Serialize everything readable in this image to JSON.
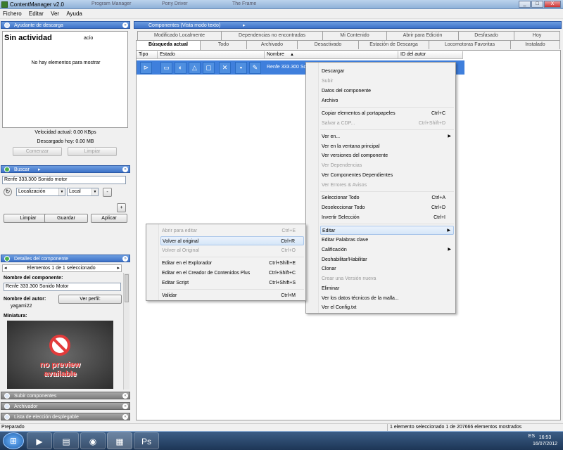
{
  "window": {
    "title": "ContentManager v2.0",
    "ghost_tabs": [
      "Program Manager",
      "Pony Driver",
      "The Frame"
    ],
    "controls": [
      "_",
      "□",
      "X"
    ]
  },
  "menubar": [
    "Fichero",
    "Editar",
    "Ver",
    "Ayuda"
  ],
  "download_panel": {
    "header": "Ayudante de descarga",
    "status": "Sin actividad",
    "status_side": "acío",
    "empty_msg": "No hay elementos para mostrar",
    "speed": "Velocidad actual: 0.00 KBps",
    "downloaded": "Descargado hoy: 0.00 MB",
    "btn_start": "Comenzar",
    "btn_clear": "Limpiar"
  },
  "search_panel": {
    "header": "Buscar",
    "query": "Renfe 333.300 Sonido motor",
    "loc": "Localización",
    "local": "Local",
    "minus": "-",
    "plus": "+",
    "btn_clear": "Limpiar",
    "btn_save": "Guardar",
    "btn_apply": "Aplicar"
  },
  "details_panel": {
    "header": "Detalles del componente",
    "nav": "Elementos 1 de 1 seleccionado",
    "name_label": "Nombre del componente:",
    "name_value": "Renfe 333.300 Sonido Motor",
    "author_label": "Nombre del autor:",
    "author_btn": "Ver perfil:",
    "author_value": "yagami22",
    "thumb_label": "Miniatura:",
    "no_preview_1": "no preview",
    "no_preview_2": "available"
  },
  "bottom_panels": [
    "Subir componentes",
    "Archivador",
    "Lista de elección desplegable"
  ],
  "components": {
    "header": "Componentes (Vista modo texto)",
    "tabs_row1": [
      "Modificado Localmente",
      "Dependencias no encontradas",
      "Mi Contenido",
      "Abrir para Edición",
      "Desfasado",
      "Hoy"
    ],
    "tabs_row2": [
      "Búsqueda actual",
      "Todo",
      "Archivado",
      "Desactivado",
      "Estación de Descarga",
      "Locomotoras Favoritas",
      "Instalado"
    ],
    "columns": [
      "Tipo",
      "Estado",
      "Nombre",
      "ID del autor"
    ],
    "row": {
      "name": "Renfe 333.300 Sonido"
    }
  },
  "context_menu": {
    "items": [
      {
        "label": "Descargar",
        "shortcut": "",
        "enabled": true
      },
      {
        "label": "Subir",
        "shortcut": "",
        "enabled": false
      },
      {
        "label": "Datos del componente",
        "shortcut": "",
        "enabled": true
      },
      {
        "label": "Archivo",
        "shortcut": "",
        "enabled": true
      },
      {
        "label": "Copiar elementos al portapapeles",
        "shortcut": "Ctrl+C",
        "enabled": true
      },
      {
        "label": "Salvar a CDP...",
        "shortcut": "Ctrl+Shift+D",
        "enabled": false
      },
      {
        "label": "Ver en...",
        "shortcut": "",
        "enabled": true
      },
      {
        "label": "Ver en la ventana principal",
        "shortcut": "",
        "enabled": true
      },
      {
        "label": "Ver versiones del componente",
        "shortcut": "",
        "enabled": true
      },
      {
        "label": "Ver Dependencias",
        "shortcut": "",
        "enabled": false
      },
      {
        "label": "Ver Componentes Dependientes",
        "shortcut": "",
        "enabled": true
      },
      {
        "label": "Ver Errores & Avisos",
        "shortcut": "",
        "enabled": false
      },
      {
        "label": "Seleccionar Todo",
        "shortcut": "Ctrl+A",
        "enabled": true
      },
      {
        "label": "Deseleccionar Todo",
        "shortcut": "Ctrl+D",
        "enabled": true
      },
      {
        "label": "Invertir Selección",
        "shortcut": "Ctrl+I",
        "enabled": true
      },
      {
        "label": "Editar",
        "shortcut": "",
        "enabled": true
      },
      {
        "label": "Editar Palabras clave",
        "shortcut": "",
        "enabled": true
      },
      {
        "label": "Calificación",
        "shortcut": "",
        "enabled": true
      },
      {
        "label": "Deshabilitar/Habilitar",
        "shortcut": "",
        "enabled": true
      },
      {
        "label": "Clonar",
        "shortcut": "",
        "enabled": true
      },
      {
        "label": "Crear una Versión nueva",
        "shortcut": "",
        "enabled": false
      },
      {
        "label": "Eliminar",
        "shortcut": "",
        "enabled": true
      },
      {
        "label": "Ver los datos técnicos de la malla...",
        "shortcut": "",
        "enabled": true
      },
      {
        "label": "Ver el Config.txt",
        "shortcut": "",
        "enabled": true
      }
    ]
  },
  "submenu": {
    "items": [
      {
        "label": "Abrir para editar",
        "shortcut": "Ctrl+E",
        "enabled": false
      },
      {
        "label": "Volver al original",
        "shortcut": "Ctrl+R",
        "enabled": true
      },
      {
        "label": "Volver al Original",
        "shortcut": "Ctrl+O",
        "enabled": false
      },
      {
        "label": "Editar en el Explorador",
        "shortcut": "Ctrl+Shift+E",
        "enabled": true
      },
      {
        "label": "Editar en el Creador de Contenidos Plus",
        "shortcut": "Ctrl+Shift+C",
        "enabled": true
      },
      {
        "label": "Editar Script",
        "shortcut": "Ctrl+Shift+S",
        "enabled": true
      },
      {
        "label": "Validar",
        "shortcut": "Ctrl+M",
        "enabled": true
      }
    ]
  },
  "statusbar": {
    "left": "Preparado",
    "right": "1 elemento seleccionado 1 de 207666 elementos mostrados"
  },
  "taskbar": {
    "time": "16:53",
    "date": "16/07/2012",
    "lang": "ES"
  },
  "colors": {
    "accent": "#3d72c8",
    "selection": "#3f7fdc"
  }
}
